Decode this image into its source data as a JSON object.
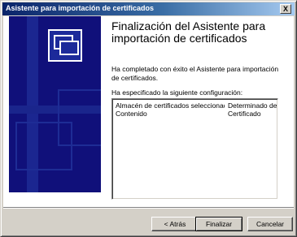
{
  "window": {
    "title": "Asistente para importación de certificados",
    "close_symbol": "X"
  },
  "side_panel": {
    "icon": "certificate-wizard-icon"
  },
  "main": {
    "heading": "Finalización del Asistente para importación de certificados",
    "completed_text": "Ha completado con éxito el Asistente para importación de certificados.",
    "spec_label": "Ha especificado la siguiente configuración:",
    "settings": [
      {
        "name": "Almacén de certificados seleccionado",
        "value": "Determinado de fo"
      },
      {
        "name": "Contenido",
        "value": "Certificado"
      }
    ]
  },
  "buttons": {
    "back": "< Atrás",
    "finish": "Finalizar",
    "cancel": "Cancelar"
  },
  "colors": {
    "title_gradient_start": "#0a246a",
    "side_panel": "#10107a",
    "dialog_face": "#d4d0c8"
  }
}
